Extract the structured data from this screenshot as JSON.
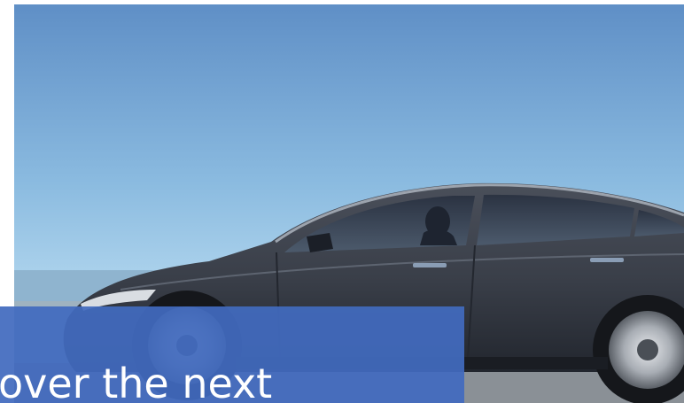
{
  "slide": {
    "photo": {
      "subject": "car-photo"
    },
    "caption": {
      "text": "over the next"
    }
  }
}
